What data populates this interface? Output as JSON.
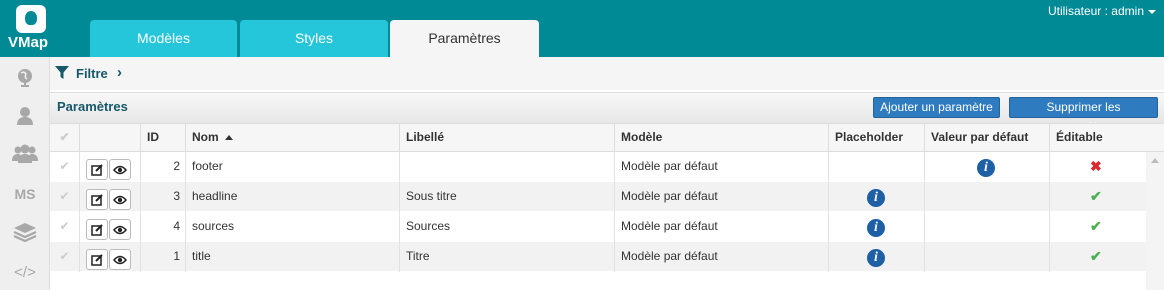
{
  "app": {
    "name": "VMap"
  },
  "user": {
    "label": "Utilisateur : admin"
  },
  "tabs": [
    {
      "label": "Modèles"
    },
    {
      "label": "Styles"
    },
    {
      "label": "Paramètres"
    }
  ],
  "sidebar": {
    "items": [
      {
        "icon": "globe-icon"
      },
      {
        "icon": "user-icon"
      },
      {
        "icon": "users-icon"
      },
      {
        "icon": "ms-icon",
        "label": "MS"
      },
      {
        "icon": "layers-icon"
      },
      {
        "icon": "code-icon",
        "label": "</>"
      }
    ]
  },
  "filter": {
    "label": "Filtre",
    "chevron": "›"
  },
  "panel": {
    "title": "Paramètres",
    "add_button": "Ajouter un paramètre",
    "delete_button": "Supprimer les paramètres"
  },
  "table": {
    "headers": {
      "check": "✔",
      "id": "ID",
      "nom": "Nom",
      "libelle": "Libellé",
      "modele": "Modèle",
      "placeholder": "Placeholder",
      "valeur": "Valeur par défaut",
      "editable": "Éditable"
    },
    "sort": {
      "column": "Nom",
      "direction": "asc"
    },
    "rows": [
      {
        "check": "✔",
        "id": "2",
        "nom": "footer",
        "libelle": "",
        "modele": "Modèle par défaut",
        "placeholder_info": false,
        "valeur_info": true,
        "editable": false
      },
      {
        "check": "✔",
        "id": "3",
        "nom": "headline",
        "libelle": "Sous titre",
        "modele": "Modèle par défaut",
        "placeholder_info": true,
        "valeur_info": false,
        "editable": true
      },
      {
        "check": "✔",
        "id": "4",
        "nom": "sources",
        "libelle": "Sources",
        "modele": "Modèle par défaut",
        "placeholder_info": true,
        "valeur_info": false,
        "editable": true
      },
      {
        "check": "✔",
        "id": "1",
        "nom": "title",
        "libelle": "Titre",
        "modele": "Modèle par défaut",
        "placeholder_info": true,
        "valeur_info": false,
        "editable": true
      }
    ],
    "info_glyph": "i",
    "yes_glyph": "✔",
    "no_glyph": "✖"
  },
  "colors": {
    "header_bg": "#008a96",
    "tab_inactive": "#26c6da",
    "button": "#2e7cbf",
    "title_text": "#17586a",
    "info": "#1e5fa6",
    "yes": "#4caf50",
    "no": "#d9282e"
  }
}
